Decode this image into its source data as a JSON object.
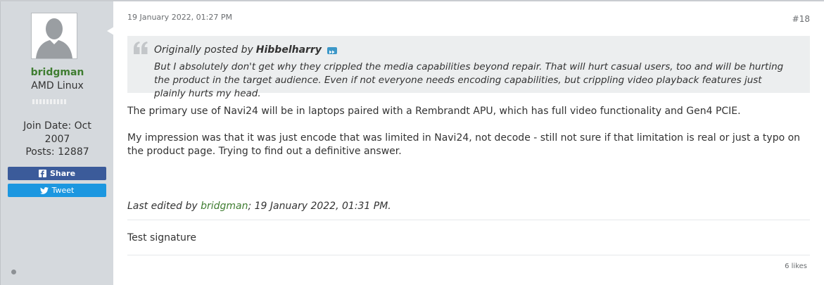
{
  "user": {
    "username": "bridgman",
    "title": "AMD Linux",
    "join_date": "Join Date: Oct 2007",
    "posts": "Posts: 12887",
    "rank_pips": 10
  },
  "social": {
    "share_label": "Share",
    "tweet_label": "Tweet"
  },
  "post": {
    "date": "19 January 2022, 01:27 PM",
    "number": "#18",
    "quote": {
      "prefix": "Originally posted by",
      "author": "Hibbelharry",
      "text": "But I absolutely don't get why they crippled the media capabilities beyond repair. That will hurt casual users, too and will be hurting the product in the target audience. Even if not everyone needs encoding capabilities, but crippling video playback features just plainly hurts my head."
    },
    "paragraphs": [
      "The primary use of Navi24 will be in laptops paired with a Rembrandt APU, which has full video functionality and Gen4 PCIE.",
      "My impression was that it was just encode that was limited in Navi24, not decode - still not sure if that limitation is real or just a typo on the product page. Trying to find out a definitive answer."
    ],
    "edited": {
      "prefix": "Last edited by",
      "user": "bridgman",
      "suffix": "; 19 January 2022, 01:31 PM."
    },
    "signature": "Test signature",
    "likes": "6 likes"
  },
  "colors": {
    "username": "#3f7d31",
    "sidebar_bg": "#d5d9dd",
    "share_bg": "#3b5b9a",
    "tweet_bg": "#1c97e0",
    "quote_bg": "#eceeef"
  }
}
